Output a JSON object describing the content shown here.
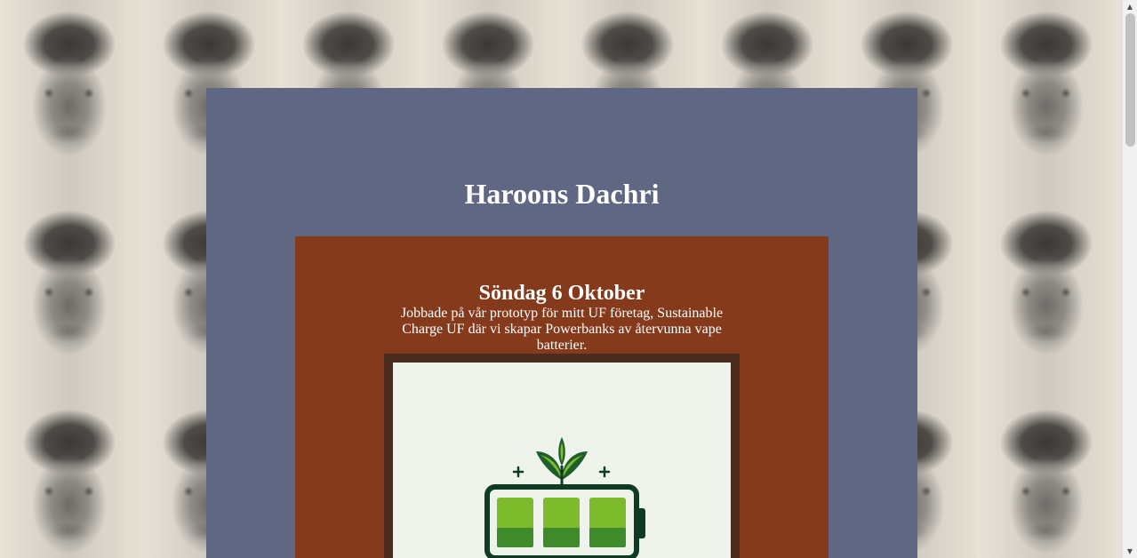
{
  "header": {
    "title": "Haroons Dachri"
  },
  "post": {
    "date": "Söndag 6 Oktober",
    "text": "Jobbade på vår prototyp för mitt UF företag, Sustainable Charge UF där vi skapar Powerbanks av återvunna vape batterier.",
    "image_icon": "battery-leaf-logo"
  },
  "colors": {
    "page_background": "#606782",
    "post_background": "#853a1c",
    "image_frame": "#4a2c1f",
    "image_background": "#eef3ec",
    "battery_green": "#7dbb2c",
    "battery_dark": "#0f3a24",
    "title_text": "#ffffff"
  }
}
